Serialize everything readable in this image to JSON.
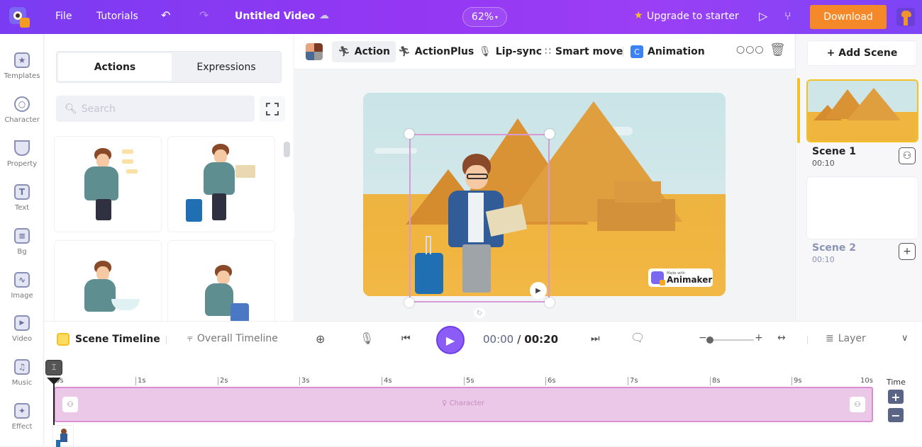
{
  "topbar": {
    "menu": [
      "File",
      "Tutorials"
    ],
    "project_title": "Untitled Video",
    "zoom_level": "62%",
    "upgrade_label": "Upgrade to starter",
    "download_label": "Download",
    "colors": {
      "gradient_start": "#7a3cf2",
      "gradient_end": "#7c45f5",
      "download": "#f5892a",
      "star": "#f5c024"
    }
  },
  "rail": {
    "items": [
      {
        "label": "Templates",
        "icon": "clapperboard-icon"
      },
      {
        "label": "Character",
        "icon": "person-icon"
      },
      {
        "label": "Property",
        "icon": "cup-icon"
      },
      {
        "label": "Text",
        "icon": "text-icon"
      },
      {
        "label": "Bg",
        "icon": "layers-icon"
      },
      {
        "label": "Image",
        "icon": "image-icon"
      },
      {
        "label": "Video",
        "icon": "video-icon"
      },
      {
        "label": "Music",
        "icon": "music-icon"
      },
      {
        "label": "Effect",
        "icon": "effect-icon"
      }
    ]
  },
  "library": {
    "tabs": [
      {
        "label": "Actions",
        "active": true
      },
      {
        "label": "Expressions",
        "active": false
      }
    ],
    "search_placeholder": "Search"
  },
  "toolbar": {
    "tools": [
      {
        "label": "Action",
        "icon": "running-person-icon",
        "active": true
      },
      {
        "label": "ActionPlus",
        "icon": "running-plus-icon",
        "active": false
      },
      {
        "label": "Lip-sync",
        "icon": "microphone-icon",
        "active": false
      },
      {
        "label": "Smart move",
        "icon": "path-icon",
        "active": false
      },
      {
        "label": "Animation",
        "icon": "animation-icon",
        "active": false
      }
    ]
  },
  "canvas": {
    "watermark_small": "Made with",
    "watermark_brand": "Animaker"
  },
  "scenes": {
    "add_label": "+ Add Scene",
    "items": [
      {
        "name": "Scene 1",
        "duration": "00:10",
        "active": true
      },
      {
        "name": "Scene 2",
        "duration": "00:10",
        "active": false
      }
    ]
  },
  "timeline": {
    "scene_tab": "Scene Timeline",
    "overall_tab": "Overall Timeline",
    "current_time": "00:00",
    "separator": "/",
    "total_time": "00:20",
    "layer_label": "Layer",
    "ruler_ticks": [
      "0s",
      "1s",
      "2s",
      "3s",
      "4s",
      "5s",
      "6s",
      "7s",
      "8s",
      "9s",
      "10s"
    ],
    "track_label": "Character",
    "time_label": "Time",
    "zoom_slider_value": 0.1
  }
}
